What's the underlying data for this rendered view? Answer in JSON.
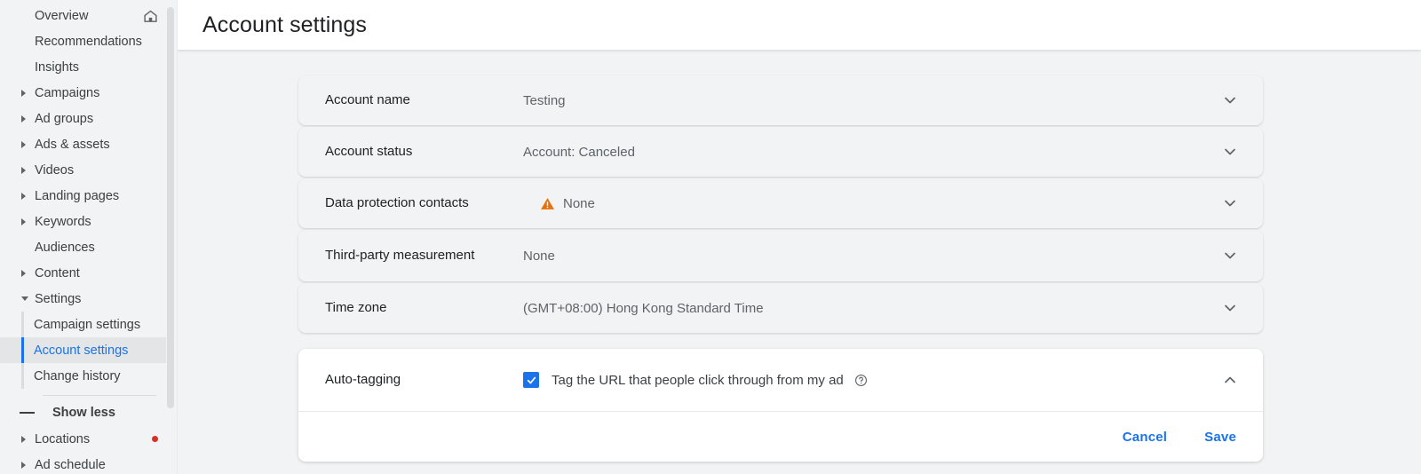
{
  "sidebar": {
    "items": [
      {
        "label": "Overview",
        "expandable": false,
        "icon": "home-icon",
        "sub": false
      },
      {
        "label": "Recommendations",
        "expandable": false,
        "sub": false
      },
      {
        "label": "Insights",
        "expandable": false,
        "sub": false
      },
      {
        "label": "Campaigns",
        "expandable": true,
        "sub": false
      },
      {
        "label": "Ad groups",
        "expandable": true,
        "sub": false
      },
      {
        "label": "Ads & assets",
        "expandable": true,
        "sub": false
      },
      {
        "label": "Videos",
        "expandable": true,
        "sub": false
      },
      {
        "label": "Landing pages",
        "expandable": true,
        "sub": false
      },
      {
        "label": "Keywords",
        "expandable": true,
        "sub": false
      },
      {
        "label": "Audiences",
        "expandable": false,
        "sub": false
      },
      {
        "label": "Content",
        "expandable": true,
        "sub": false
      },
      {
        "label": "Settings",
        "expandable": true,
        "expanded": true,
        "sub": false
      },
      {
        "label": "Campaign settings",
        "sub": true,
        "selected": false
      },
      {
        "label": "Account settings",
        "sub": true,
        "selected": true
      },
      {
        "label": "Change history",
        "sub": true,
        "selected": false
      }
    ],
    "show_less_label": "Show less",
    "after_items": [
      {
        "label": "Locations",
        "expandable": true,
        "badge": "red-dot"
      },
      {
        "label": "Ad schedule",
        "expandable": true
      }
    ],
    "accent_color": "#1a73e8",
    "badge_color": "#d93025"
  },
  "header": {
    "title": "Account settings"
  },
  "settings": {
    "rows": [
      {
        "label": "Account name",
        "value": "Testing",
        "warning": false,
        "chevron": "chevron-down-icon"
      },
      {
        "label": "Account status",
        "value": "Account: Canceled",
        "warning": false,
        "chevron": "chevron-down-icon"
      },
      {
        "label": "Data protection contacts",
        "value": "None",
        "warning": true,
        "chevron": "chevron-down-icon"
      },
      {
        "label": "Third-party measurement",
        "value": "None",
        "warning": false,
        "chevron": "chevron-down-icon"
      },
      {
        "label": "Time zone",
        "value": "(GMT+08:00) Hong Kong Standard Time",
        "warning": false,
        "chevron": "chevron-down-icon"
      }
    ],
    "warning_color": "#e8710a"
  },
  "autotagging": {
    "label": "Auto-tagging",
    "checkbox_label": "Tag the URL that people click through from my ad",
    "checked": true,
    "help_icon": "help-circle-icon",
    "chevron": "chevron-up-icon",
    "cancel_label": "Cancel",
    "save_label": "Save"
  }
}
